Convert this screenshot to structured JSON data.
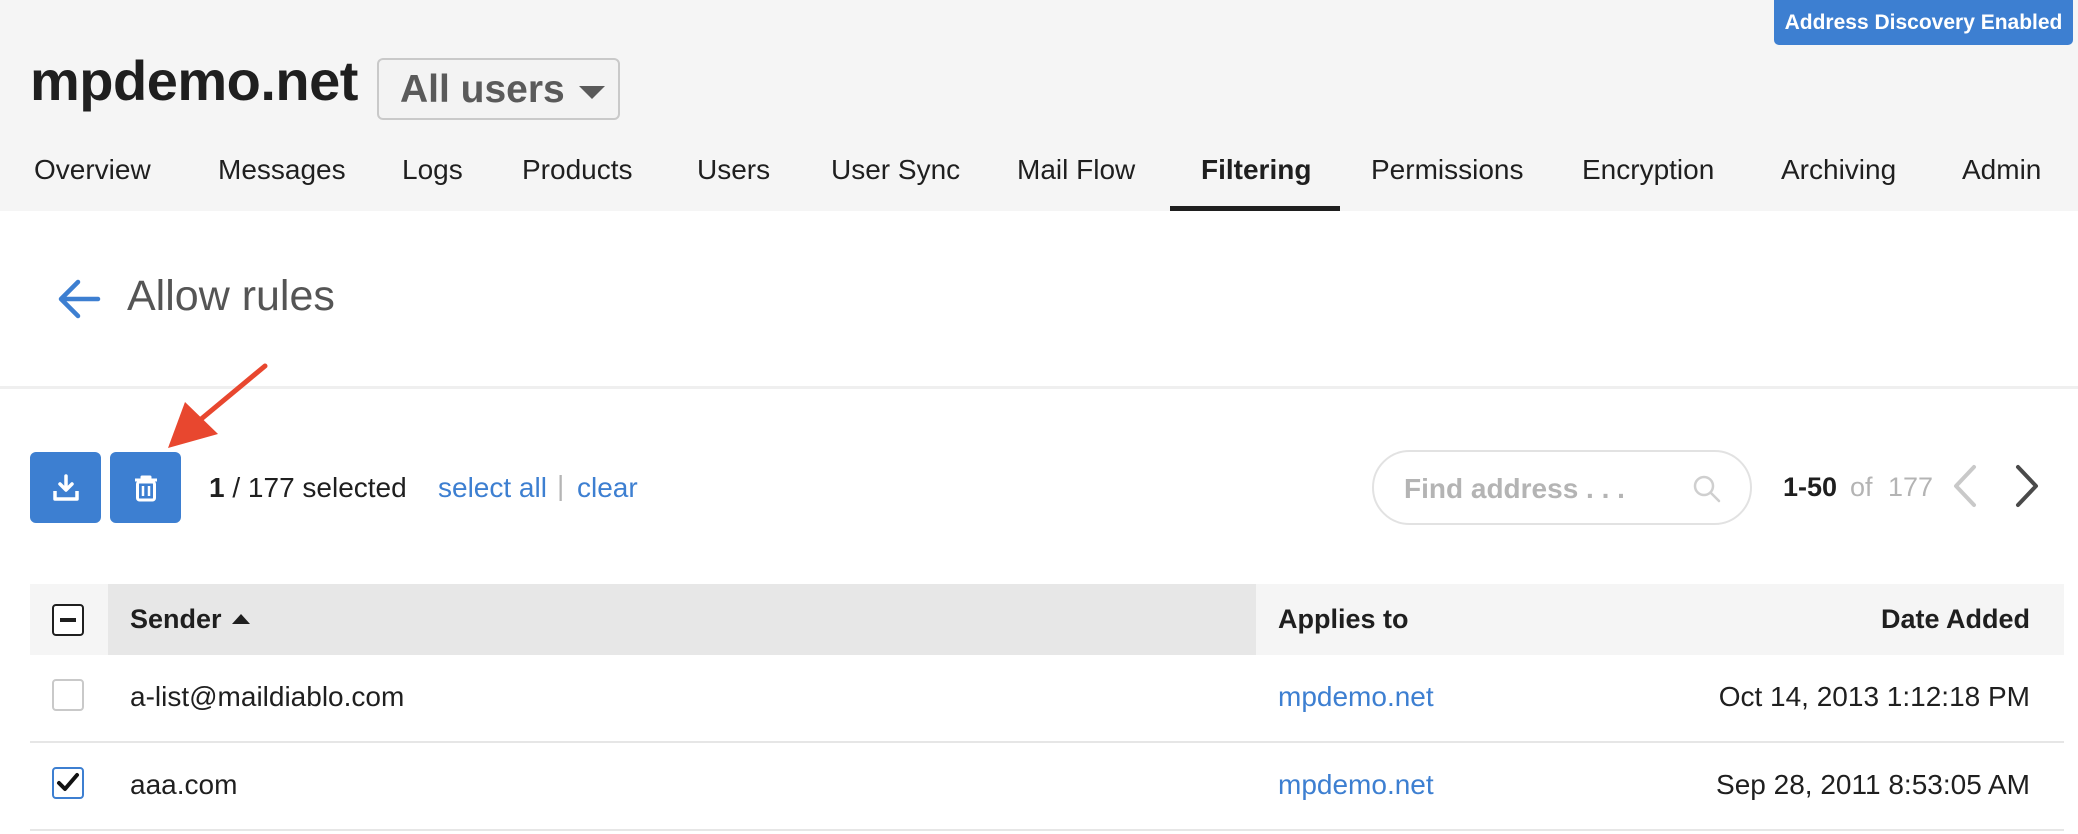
{
  "header": {
    "badge": "Address Discovery Enabled",
    "domain": "mpdemo.net",
    "user_filter": "All users",
    "nav": [
      {
        "label": "Overview",
        "active": false
      },
      {
        "label": "Messages",
        "active": false
      },
      {
        "label": "Logs",
        "active": false
      },
      {
        "label": "Products",
        "active": false
      },
      {
        "label": "Users",
        "active": false
      },
      {
        "label": "User Sync",
        "active": false
      },
      {
        "label": "Mail Flow",
        "active": false
      },
      {
        "label": "Filtering",
        "active": true
      },
      {
        "label": "Permissions",
        "active": false
      },
      {
        "label": "Encryption",
        "active": false
      },
      {
        "label": "Archiving",
        "active": false
      },
      {
        "label": "Admin",
        "active": false
      }
    ]
  },
  "page": {
    "title": "Allow rules"
  },
  "toolbar": {
    "selected_count": "1",
    "selected_total": "/ 177 selected",
    "select_all": "select all",
    "separator": "|",
    "clear": "clear",
    "search_placeholder": "Find address . . .",
    "pager_range": "1-50",
    "pager_of": "of",
    "pager_total": "177"
  },
  "table": {
    "columns": {
      "sender": "Sender",
      "applies": "Applies to",
      "date": "Date Added"
    },
    "rows": [
      {
        "sender": "a-list@maildiablo.com",
        "applies": "mpdemo.net",
        "date": "Oct 14, 2013 1:12:18 PM",
        "checked": false
      },
      {
        "sender": "aaa.com",
        "applies": "mpdemo.net",
        "date": "Sep 28, 2011 8:53:05 AM",
        "checked": true
      }
    ]
  },
  "colors": {
    "accent": "#3d7fd1",
    "annotation_arrow": "#e8472f"
  }
}
